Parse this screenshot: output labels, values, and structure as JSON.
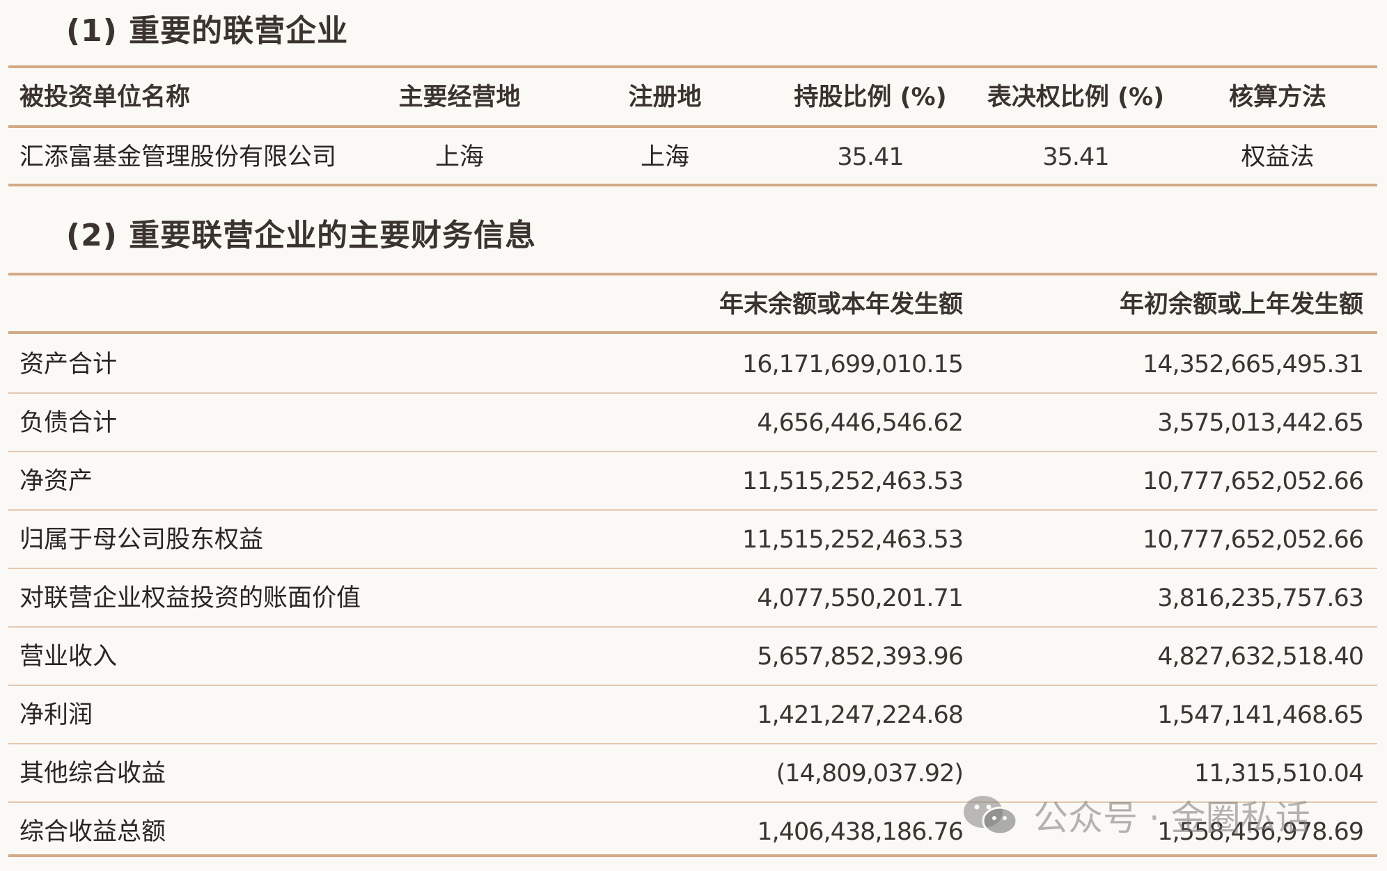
{
  "section1": {
    "title": "(1) 重要的联营企业"
  },
  "table1": {
    "headers": [
      "被投资单位名称",
      "主要经营地",
      "注册地",
      "持股比例 (%)",
      "表决权比例 (%)",
      "核算方法"
    ],
    "rows": [
      [
        "汇添富基金管理股份有限公司",
        "上海",
        "上海",
        "35.41",
        "35.41",
        "权益法"
      ]
    ]
  },
  "section2": {
    "title": "(2) 重要联营企业的主要财务信息"
  },
  "table2": {
    "headers": [
      "",
      "年末余额或本年发生额",
      "年初余额或上年发生额"
    ],
    "rows": [
      [
        "资产合计",
        "16,171,699,010.15",
        "14,352,665,495.31"
      ],
      [
        "负债合计",
        "4,656,446,546.62",
        "3,575,013,442.65"
      ],
      [
        "净资产",
        "11,515,252,463.53",
        "10,777,652,052.66"
      ],
      [
        "归属于母公司股东权益",
        "11,515,252,463.53",
        "10,777,652,052.66"
      ],
      [
        "对联营企业权益投资的账面价值",
        "4,077,550,201.71",
        "3,816,235,757.63"
      ],
      [
        "营业收入",
        "5,657,852,393.96",
        "4,827,632,518.40"
      ],
      [
        "净利润",
        "1,421,247,224.68",
        "1,547,141,468.65"
      ],
      [
        "其他综合收益",
        "(14,809,037.92)",
        "11,315,510.04"
      ],
      [
        "综合收益总额",
        "1,406,438,186.76",
        "1,558,456,978.69"
      ]
    ]
  },
  "watermark": {
    "text": "公众号 · 金圈私话",
    "icon": "wechat-icon"
  },
  "colors": {
    "rule": "#d3a986",
    "background": "#fbf9f6",
    "text": "#2a2522"
  }
}
